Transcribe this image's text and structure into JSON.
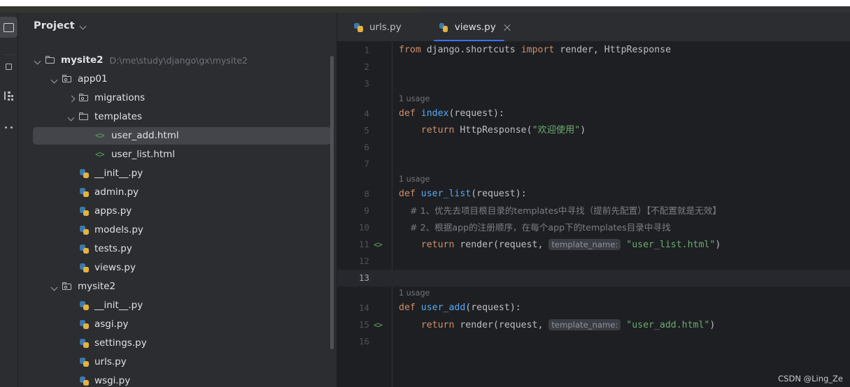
{
  "rail": {
    "items": [
      {
        "name": "project-tool-icon",
        "active": true
      },
      {
        "name": "commit-tool-icon",
        "active": false
      },
      {
        "name": "structure-tool-icon",
        "active": false
      },
      {
        "name": "more-tools-icon",
        "active": false
      }
    ]
  },
  "panel": {
    "title": "Project",
    "chevron": "chevron-down-icon",
    "tree": [
      {
        "label": "mysite2",
        "hint": "D:\\me\\study\\django\\gx\\mysite2",
        "icon": "folder",
        "arrow": "down",
        "indent": 0,
        "bold": true,
        "selected": false
      },
      {
        "label": "app01",
        "hint": "",
        "icon": "package",
        "arrow": "down",
        "indent": 1,
        "bold": false,
        "selected": false
      },
      {
        "label": "migrations",
        "hint": "",
        "icon": "package",
        "arrow": "right",
        "indent": 2,
        "bold": false,
        "selected": false
      },
      {
        "label": "templates",
        "hint": "",
        "icon": "folder",
        "arrow": "down",
        "indent": 2,
        "bold": false,
        "selected": false
      },
      {
        "label": "user_add.html",
        "hint": "",
        "icon": "html",
        "arrow": "none",
        "indent": 3,
        "bold": false,
        "selected": true
      },
      {
        "label": "user_list.html",
        "hint": "",
        "icon": "html",
        "arrow": "none",
        "indent": 3,
        "bold": false,
        "selected": false
      },
      {
        "label": "__init__.py",
        "hint": "",
        "icon": "python",
        "arrow": "none",
        "indent": 2,
        "bold": false,
        "selected": false
      },
      {
        "label": "admin.py",
        "hint": "",
        "icon": "python",
        "arrow": "none",
        "indent": 2,
        "bold": false,
        "selected": false
      },
      {
        "label": "apps.py",
        "hint": "",
        "icon": "python",
        "arrow": "none",
        "indent": 2,
        "bold": false,
        "selected": false
      },
      {
        "label": "models.py",
        "hint": "",
        "icon": "python",
        "arrow": "none",
        "indent": 2,
        "bold": false,
        "selected": false
      },
      {
        "label": "tests.py",
        "hint": "",
        "icon": "python",
        "arrow": "none",
        "indent": 2,
        "bold": false,
        "selected": false
      },
      {
        "label": "views.py",
        "hint": "",
        "icon": "python",
        "arrow": "none",
        "indent": 2,
        "bold": false,
        "selected": false
      },
      {
        "label": "mysite2",
        "hint": "",
        "icon": "package",
        "arrow": "down",
        "indent": 1,
        "bold": false,
        "selected": false
      },
      {
        "label": "__init__.py",
        "hint": "",
        "icon": "python",
        "arrow": "none",
        "indent": 2,
        "bold": false,
        "selected": false
      },
      {
        "label": "asgi.py",
        "hint": "",
        "icon": "python",
        "arrow": "none",
        "indent": 2,
        "bold": false,
        "selected": false
      },
      {
        "label": "settings.py",
        "hint": "",
        "icon": "python",
        "arrow": "none",
        "indent": 2,
        "bold": false,
        "selected": false
      },
      {
        "label": "urls.py",
        "hint": "",
        "icon": "python",
        "arrow": "none",
        "indent": 2,
        "bold": false,
        "selected": false
      },
      {
        "label": "wsgi.py",
        "hint": "",
        "icon": "python",
        "arrow": "none",
        "indent": 2,
        "bold": false,
        "selected": false
      }
    ]
  },
  "editor": {
    "tabs": [
      {
        "label": "urls.py",
        "icon": "python",
        "active": false,
        "closable": false
      },
      {
        "label": "views.py",
        "icon": "python",
        "active": true,
        "closable": true
      }
    ],
    "active_tab_accent": "#3574f0",
    "lines": [
      {
        "no": "1",
        "gutter": "",
        "current": false,
        "tokens": [
          {
            "t": "from ",
            "c": "kw"
          },
          {
            "t": "django.shortcuts ",
            "c": "pln"
          },
          {
            "t": "import ",
            "c": "kw"
          },
          {
            "t": "render, HttpResponse",
            "c": "pln"
          }
        ]
      },
      {
        "no": "2",
        "gutter": "",
        "current": false,
        "tokens": []
      },
      {
        "no": "3",
        "gutter": "",
        "current": false,
        "tokens": []
      },
      {
        "usage": "1 usage"
      },
      {
        "no": "4",
        "gutter": "",
        "current": false,
        "tokens": [
          {
            "t": "def ",
            "c": "kw"
          },
          {
            "t": "index",
            "c": "fn"
          },
          {
            "t": "(request):",
            "c": "pln"
          }
        ]
      },
      {
        "no": "5",
        "gutter": "",
        "current": false,
        "tokens": [
          {
            "t": "    return ",
            "c": "kw"
          },
          {
            "t": "HttpResponse(",
            "c": "pln"
          },
          {
            "t": "\"欢迎使用\"",
            "c": "str"
          },
          {
            "t": ")",
            "c": "pln"
          }
        ]
      },
      {
        "no": "6",
        "gutter": "",
        "current": false,
        "tokens": []
      },
      {
        "no": "7",
        "gutter": "",
        "current": false,
        "tokens": []
      },
      {
        "usage": "1 usage"
      },
      {
        "no": "8",
        "gutter": "",
        "current": false,
        "tokens": [
          {
            "t": "def ",
            "c": "kw"
          },
          {
            "t": "user_list",
            "c": "fn"
          },
          {
            "t": "(request):",
            "c": "pln"
          }
        ]
      },
      {
        "no": "9",
        "gutter": "",
        "current": false,
        "tokens": [
          {
            "t": "    # 1、优先去项目根目录的templates中寻找（提前先配置）【不配置就是无效】",
            "c": "cmt cmt-cn"
          }
        ]
      },
      {
        "no": "10",
        "gutter": "",
        "current": false,
        "tokens": [
          {
            "t": "    # 2、根据app的注册顺序，在每个app下的templates目录中寻找",
            "c": "cmt cmt-cn"
          }
        ]
      },
      {
        "no": "11",
        "gutter": "<>",
        "current": false,
        "tokens": [
          {
            "t": "    return ",
            "c": "kw"
          },
          {
            "t": "render(request, ",
            "c": "pln"
          },
          {
            "t": "template_name:",
            "c": "chip"
          },
          {
            "t": " ",
            "c": "pln"
          },
          {
            "t": "\"user_list.html\"",
            "c": "str"
          },
          {
            "t": ")",
            "c": "pln"
          }
        ]
      },
      {
        "no": "12",
        "gutter": "",
        "current": false,
        "tokens": []
      },
      {
        "no": "13",
        "gutter": "",
        "current": true,
        "tokens": []
      },
      {
        "usage": "1 usage"
      },
      {
        "no": "14",
        "gutter": "",
        "current": false,
        "tokens": [
          {
            "t": "def ",
            "c": "kw"
          },
          {
            "t": "user_add",
            "c": "fn"
          },
          {
            "t": "(request):",
            "c": "pln"
          }
        ]
      },
      {
        "no": "15",
        "gutter": "<>",
        "current": false,
        "tokens": [
          {
            "t": "    return ",
            "c": "kw"
          },
          {
            "t": "render(request, ",
            "c": "pln"
          },
          {
            "t": "template_name:",
            "c": "chip"
          },
          {
            "t": " ",
            "c": "pln"
          },
          {
            "t": "\"user_add.html\"",
            "c": "str"
          },
          {
            "t": ")",
            "c": "pln"
          }
        ]
      },
      {
        "no": "16",
        "gutter": "",
        "current": false,
        "tokens": []
      }
    ]
  },
  "watermark": "CSDN @Ling_Ze"
}
